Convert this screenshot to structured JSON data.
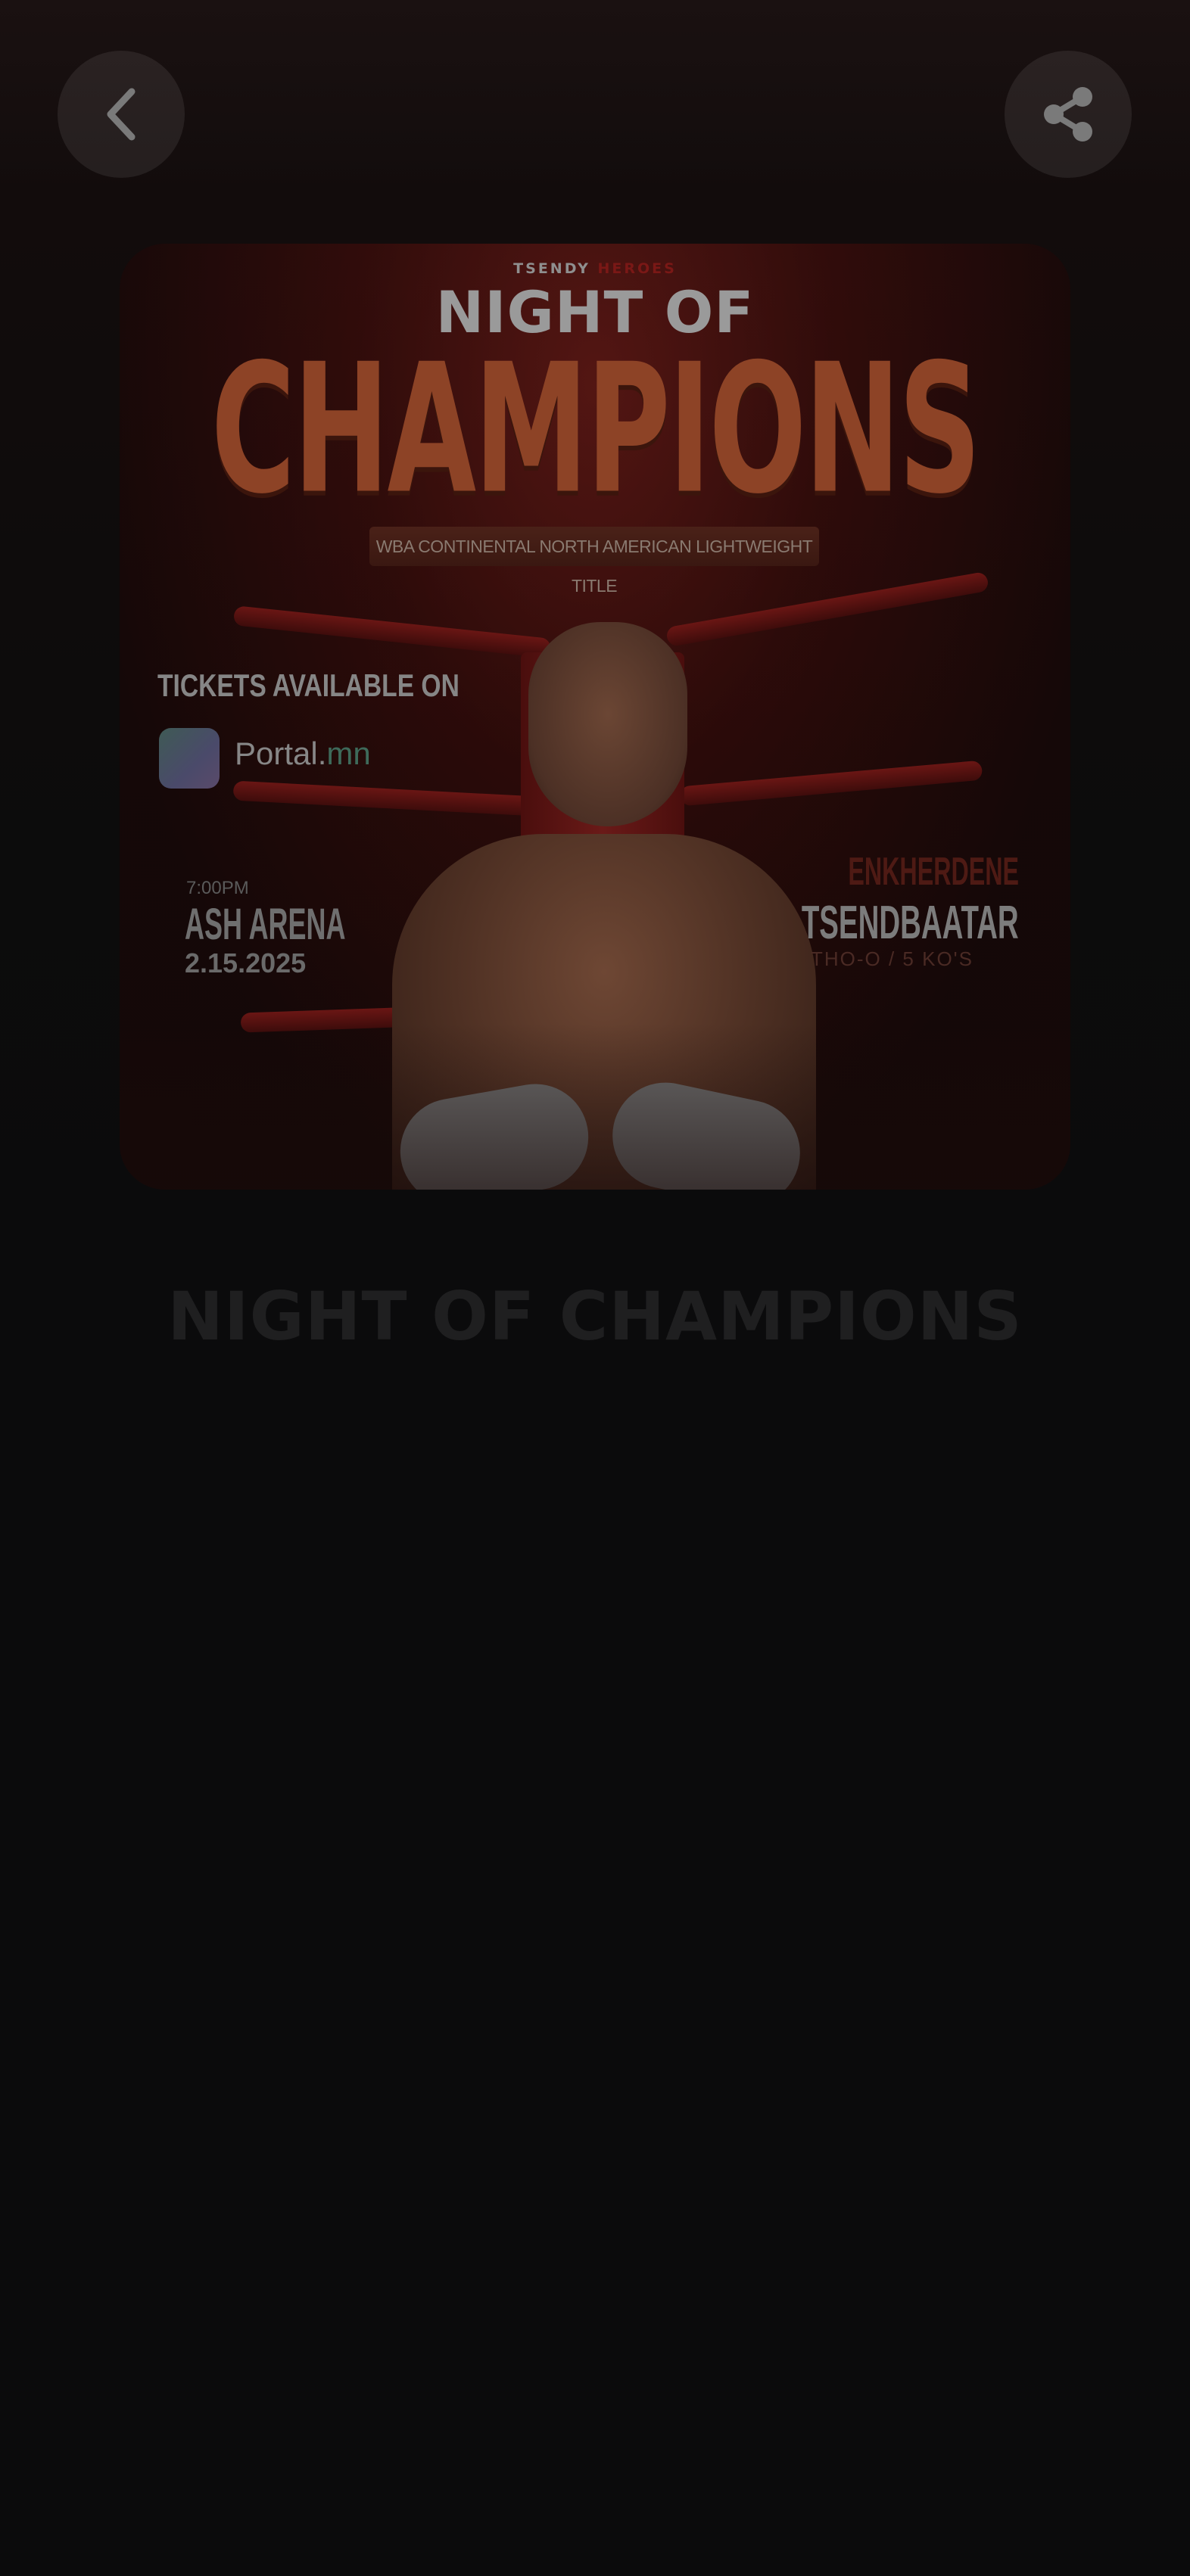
{
  "header": {
    "back_icon": "chevron-left-icon",
    "share_icon": "share-icon"
  },
  "poster": {
    "brand_main": "TSENDY",
    "brand_accent": "HEROES",
    "title_line1": "NIGHT OF",
    "title_line2": "CHAMPIONS",
    "ribbon_text": "WBA CONTINENTAL NORTH AMERICAN LIGHTWEIGHT TITLE",
    "tickets_text": "TICKETS AVAILABLE ON",
    "portal_main": "Portal.",
    "portal_accent": "mn",
    "venue_small": "7:00PM",
    "venue_name": "ASH ARENA",
    "venue_date": "2.15.2025",
    "fighter_first": "ENKHERDENE",
    "fighter_last": "TSENDBAATAR",
    "fighter_record": "THO-O / 5 KO'S"
  },
  "event": {
    "title": "NIGHT OF CHAMPIONS"
  },
  "colors": {
    "background": "#0b0b0c",
    "accent_red": "#7a1816",
    "title_text": "#1f1f20"
  }
}
